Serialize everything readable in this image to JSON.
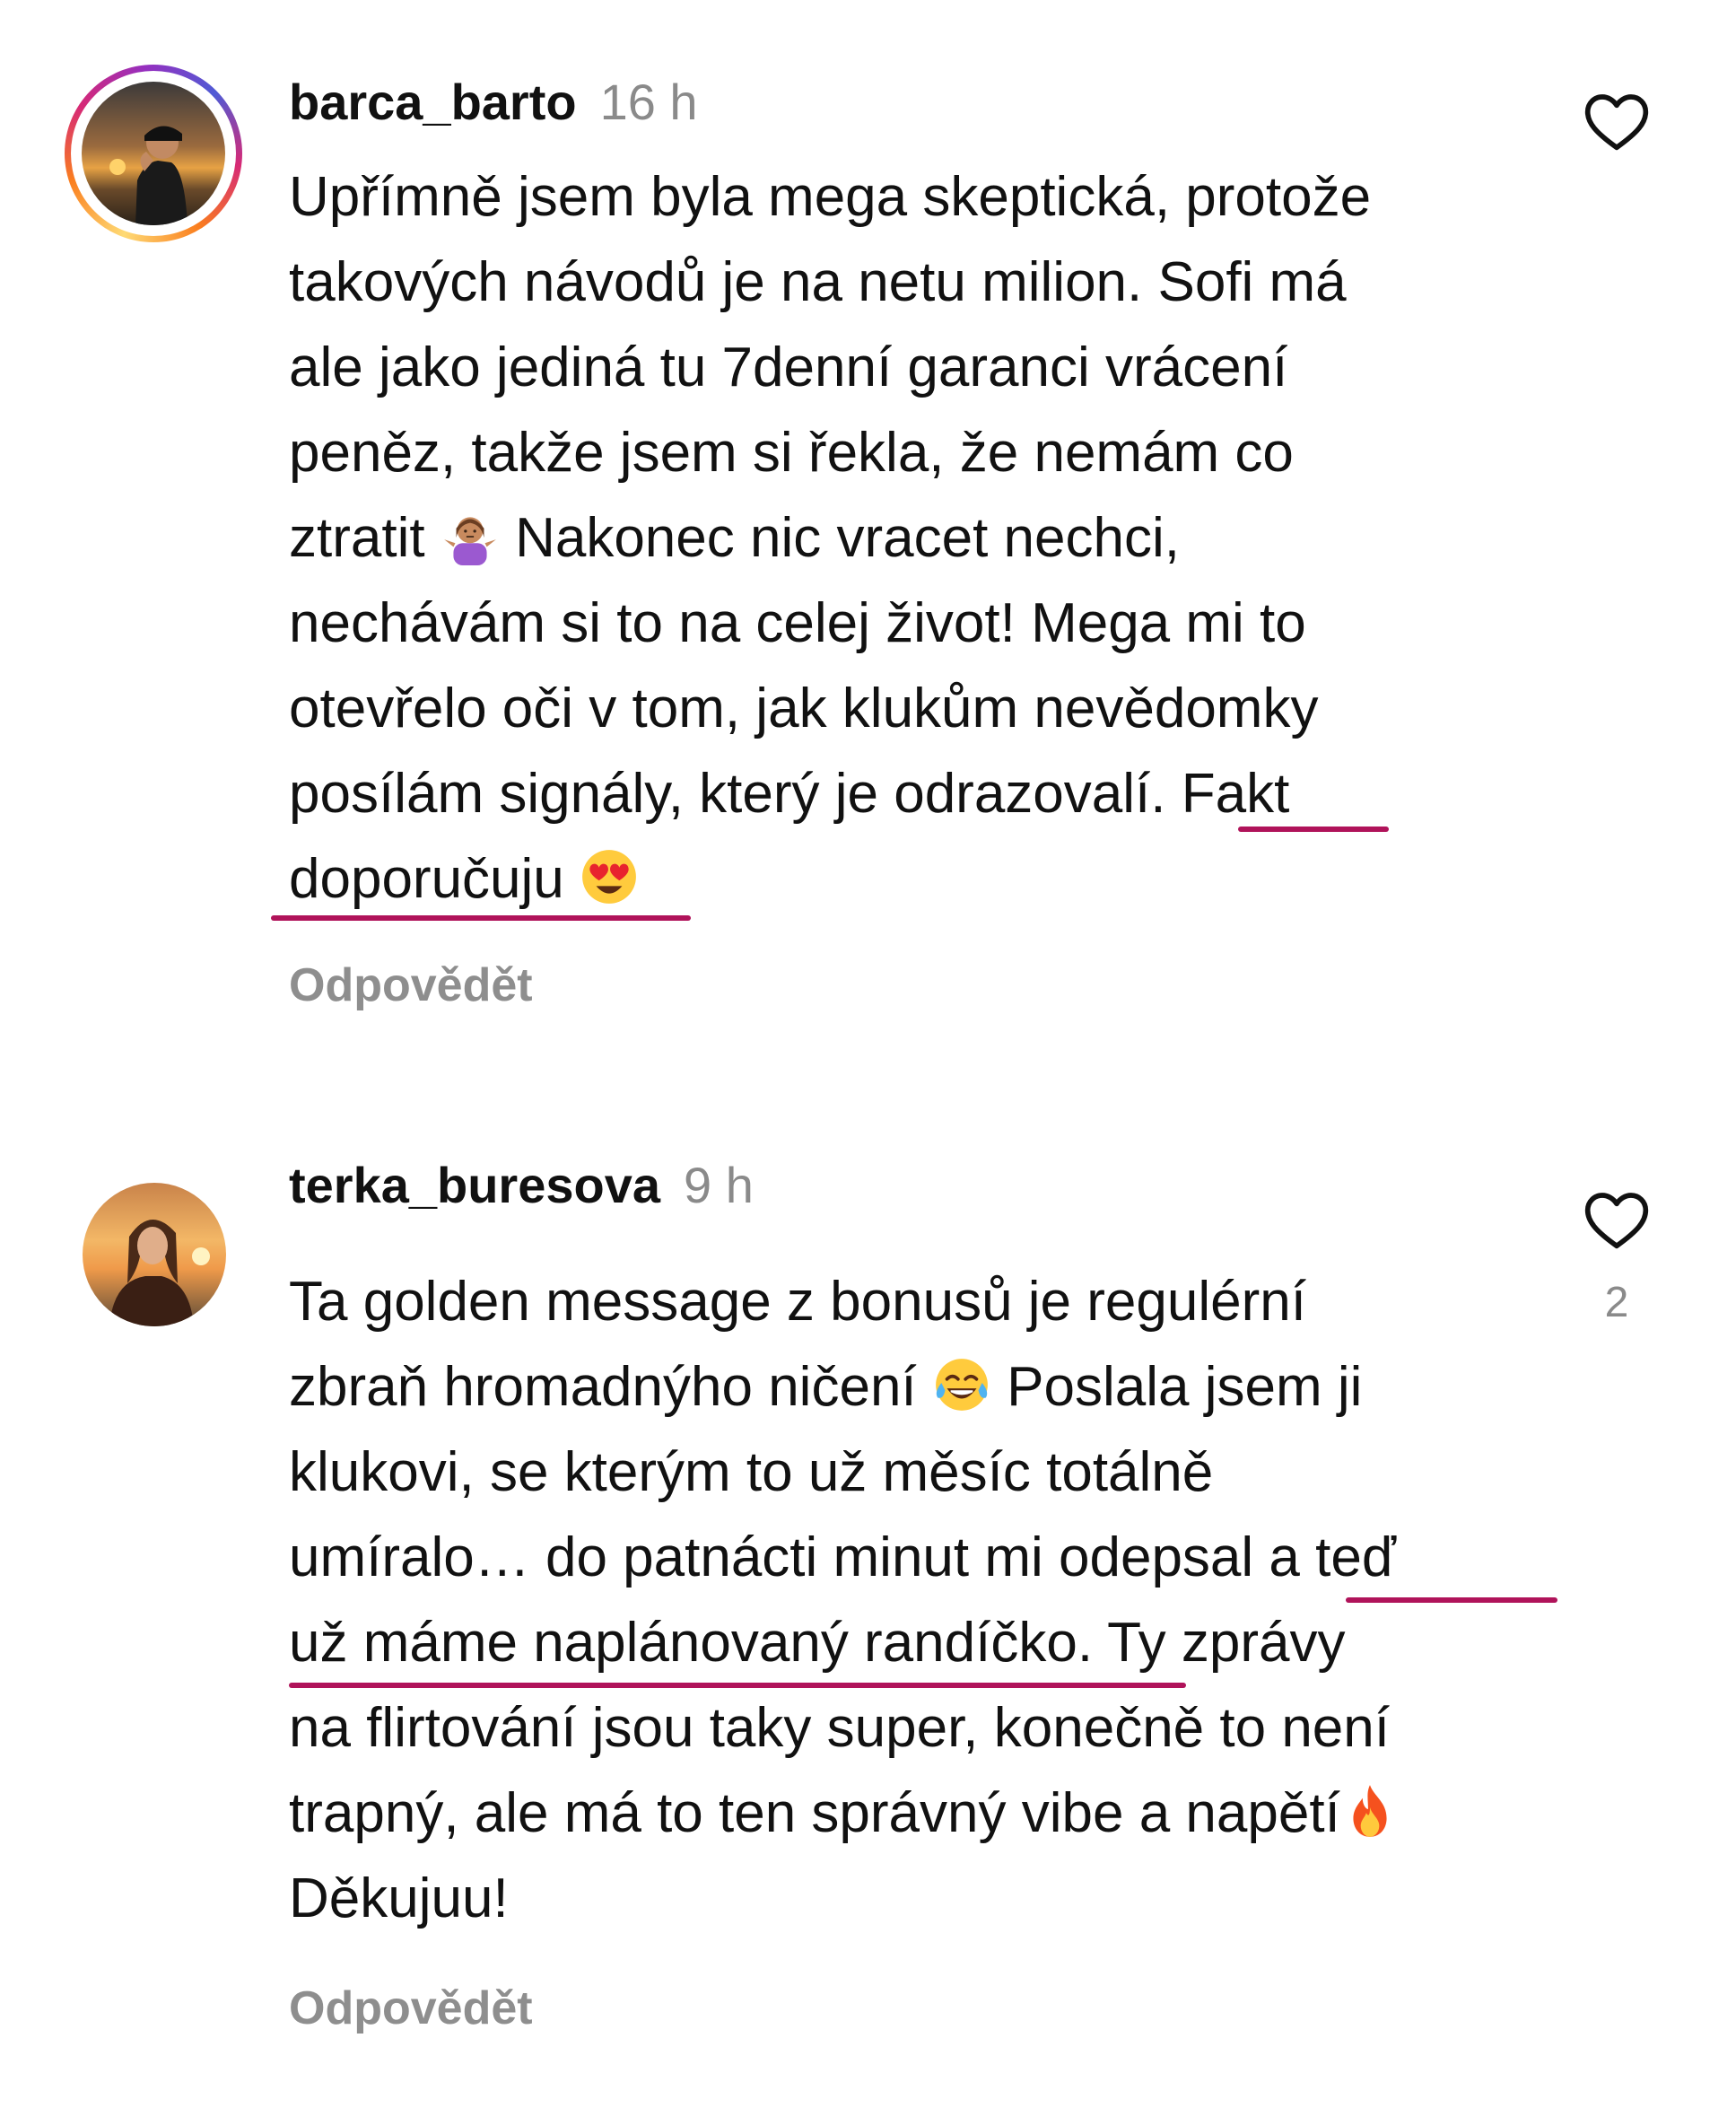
{
  "comments": [
    {
      "username": "barca_barto",
      "time": "16 h",
      "lines": [
        "Upřímně jsem byla mega skeptická, protože",
        "takových návodů je na netu milion. Sofi má",
        "ale jako jediná tu 7denní garanci vrácení",
        "peněz, takže jsem si řekla, že nemám co",
        "Nakonec nic vracet nechci,",
        "nechávám si to na celej život! Mega mi to",
        "otevřelo oči v tom, jak klukům nevědomky",
        "posílám signály, který je odrazovalí. Fakt",
        "doporučuju"
      ],
      "line5_prefix": "ztratit",
      "emoji_shrug": "person-shrugging-emoji",
      "emoji_heart_eyes": "smiling-face-heart-eyes-emoji",
      "reply_label": "Odpovědět",
      "likes": ""
    },
    {
      "username": "terka_buresova",
      "time": "9 h",
      "lines": [
        "Ta golden message z bonusů je regulérní",
        "Poslala jsem ji",
        "klukovi, se kterým to už měsíc totálně",
        "umíralo… do patnácti minut mi odepsal a teď",
        "už máme naplánovaný randíčko. Ty zprávy",
        "na flirtování jsou taky super, konečně to není",
        "trapný, ale má to ten správný vibe a napětí",
        "Děkujuu!"
      ],
      "line2_prefix": "zbraň hromadnýho ničení",
      "emoji_laugh": "tears-of-joy-emoji",
      "emoji_fire": "fire-emoji",
      "reply_label": "Odpovědět",
      "likes": "2"
    }
  ],
  "colors": {
    "underline": "#b0135a",
    "muted": "#8a8a8a"
  },
  "icons": {
    "like": "heart-outline-icon"
  }
}
